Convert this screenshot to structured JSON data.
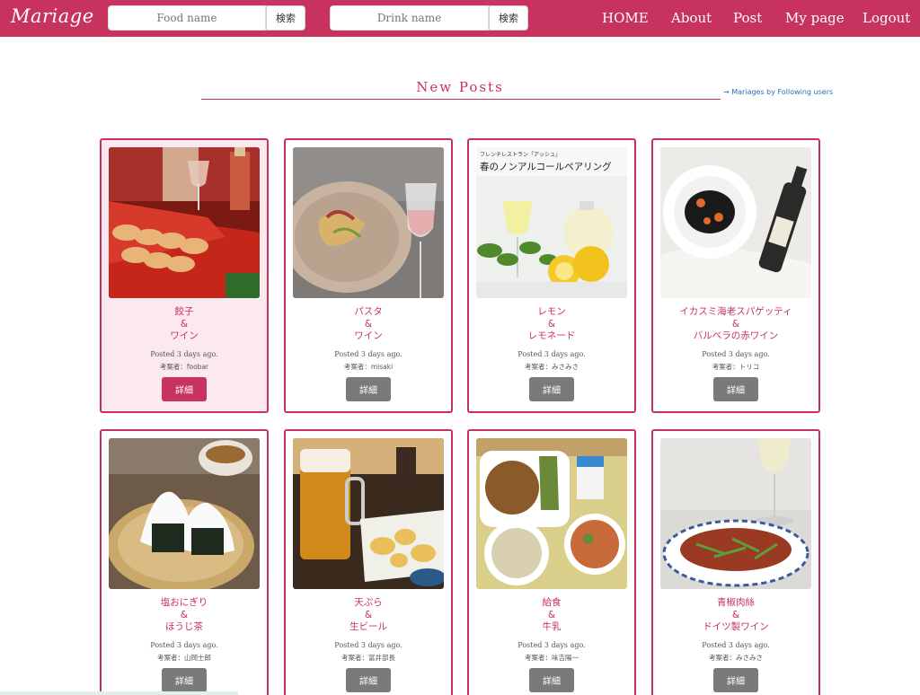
{
  "header": {
    "logo": "Mariage",
    "food_search": {
      "placeholder": "Food name",
      "button": "検索"
    },
    "drink_search": {
      "placeholder": "Drink name",
      "button": "検索"
    },
    "nav": [
      "HOME",
      "About",
      "Post",
      "My page",
      "Logout"
    ]
  },
  "main": {
    "title": "New Posts",
    "following_link": "→ Mariages by Following users",
    "posts": [
      {
        "food": "餃子",
        "amp": "&",
        "drink": "ワイン",
        "posted": "Posted 3 days ago.",
        "author": "考案者：foobar",
        "button": "詳細"
      },
      {
        "food": "パスタ",
        "amp": "&",
        "drink": "ワイン",
        "posted": "Posted 3 days ago.",
        "author": "考案者：misaki",
        "button": "詳細"
      },
      {
        "food": "レモン",
        "amp": "&",
        "drink": "レモネード",
        "posted": "Posted 3 days ago.",
        "author": "考案者：みさみさ",
        "button": "詳細",
        "image_caption_1": "フレンチレストラン「アッシュ」",
        "image_caption_2": "春のノンアルコールペアリング"
      },
      {
        "food": "イカスミ海老スパゲッティ",
        "amp": "&",
        "drink": "バルベラの赤ワイン",
        "posted": "Posted 3 days ago.",
        "author": "考案者：トリコ",
        "button": "詳細"
      },
      {
        "food": "塩おにぎり",
        "amp": "&",
        "drink": "ほうじ茶",
        "posted": "Posted 3 days ago.",
        "author": "考案者：山岡士郎",
        "button": "詳細"
      },
      {
        "food": "天ぷら",
        "amp": "&",
        "drink": "生ビール",
        "posted": "Posted 3 days ago.",
        "author": "考案者：富井部長",
        "button": "詳細"
      },
      {
        "food": "給食",
        "amp": "&",
        "drink": "牛乳",
        "posted": "Posted 3 days ago.",
        "author": "考案者：味吉陽一",
        "button": "詳細"
      },
      {
        "food": "青椒肉絲",
        "amp": "&",
        "drink": "ドイツ製ワイン",
        "posted": "Posted 3 days ago.",
        "author": "考案者：みさみさ",
        "button": "詳細"
      }
    ]
  },
  "colors": {
    "brand": "#c8325f",
    "button_gray": "#7a7a7a",
    "highlight_card": "#fbe9ef"
  }
}
